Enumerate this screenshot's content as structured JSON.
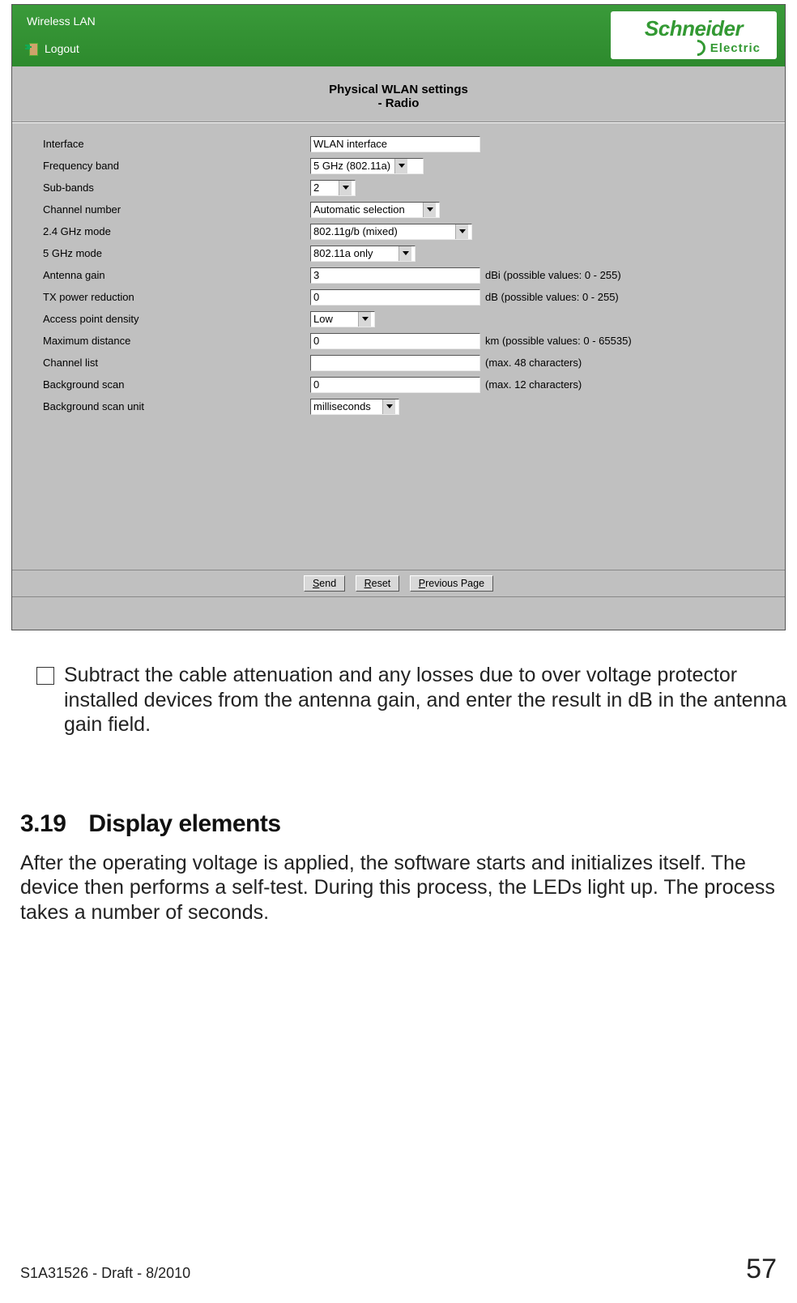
{
  "header": {
    "app_title": "Wireless LAN",
    "logout_label": "Logout",
    "logo_main": "Schneider",
    "logo_sub": "Electric"
  },
  "panel": {
    "title_line1": "Physical WLAN settings",
    "title_line2": "- Radio"
  },
  "form": {
    "interface": {
      "label": "Interface",
      "value": "WLAN interface"
    },
    "freq_band": {
      "label": "Frequency band",
      "value": "5 GHz (802.11a)"
    },
    "sub_bands": {
      "label": "Sub-bands",
      "value": "2"
    },
    "channel_number": {
      "label": "Channel number",
      "value": "Automatic selection"
    },
    "mode_24": {
      "label": "2.4 GHz mode",
      "value": "802.11g/b (mixed)"
    },
    "mode_5": {
      "label": "5 GHz mode",
      "value": "802.11a only"
    },
    "antenna_gain": {
      "label": "Antenna gain",
      "value": "3",
      "hint": "dBi (possible values: 0 - 255)"
    },
    "tx_power": {
      "label": "TX power reduction",
      "value": "0",
      "hint": "dB (possible values: 0 - 255)"
    },
    "ap_density": {
      "label": "Access point density",
      "value": "Low"
    },
    "max_distance": {
      "label": "Maximum distance",
      "value": "0",
      "hint": "km (possible values: 0 - 65535)"
    },
    "channel_list": {
      "label": "Channel list",
      "value": "",
      "hint": "(max. 48 characters)"
    },
    "bg_scan": {
      "label": "Background scan",
      "value": "0",
      "hint": "(max. 12 characters)"
    },
    "bg_scan_unit": {
      "label": "Background scan unit",
      "value": "milliseconds"
    }
  },
  "buttons": {
    "send": "Send",
    "reset": "Reset",
    "previous": "Previous Page"
  },
  "doc": {
    "instruction": "Subtract the cable attenuation and any losses due to over voltage protector installed devices from the antenna gain, and enter the result in dB in the antenna gain field.",
    "section_number": "3.19",
    "section_title": "Display elements",
    "paragraph": "After the operating voltage is applied, the software starts and initializes itself. The device then performs a self-test. During this process, the LEDs light up. The process takes a number of seconds."
  },
  "footer": {
    "docref": "S1A31526 - Draft  - 8/2010",
    "page": "57"
  }
}
